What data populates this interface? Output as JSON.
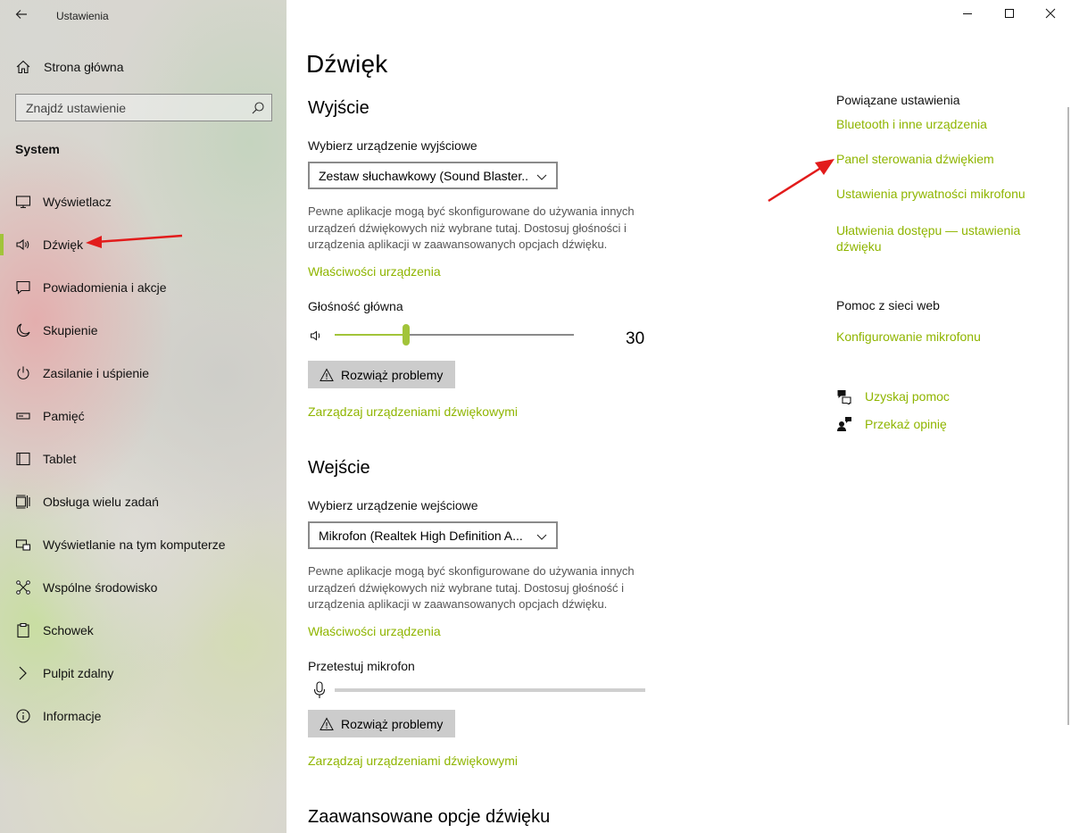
{
  "window": {
    "app_title": "Ustawienia",
    "controls": [
      "minimize-icon",
      "maximize-icon",
      "close-icon"
    ]
  },
  "sidebar": {
    "home_label": "Strona główna",
    "search_placeholder": "Znajdź ustawienie",
    "section": "System",
    "items": [
      {
        "label": "Wyświetlacz",
        "icon": "monitor-icon"
      },
      {
        "label": "Dźwięk",
        "icon": "speaker-icon",
        "active": true
      },
      {
        "label": "Powiadomienia i akcje",
        "icon": "notification-icon"
      },
      {
        "label": "Skupienie",
        "icon": "moon-icon"
      },
      {
        "label": "Zasilanie i uśpienie",
        "icon": "power-icon"
      },
      {
        "label": "Pamięć",
        "icon": "storage-icon"
      },
      {
        "label": "Tablet",
        "icon": "tablet-icon"
      },
      {
        "label": "Obsługa wielu zadań",
        "icon": "multitasking-icon"
      },
      {
        "label": "Wyświetlanie na tym komputerze",
        "icon": "projecting-icon"
      },
      {
        "label": "Wspólne środowisko",
        "icon": "shared-experiences-icon"
      },
      {
        "label": "Schowek",
        "icon": "clipboard-icon"
      },
      {
        "label": "Pulpit zdalny",
        "icon": "remote-desktop-icon"
      },
      {
        "label": "Informacje",
        "icon": "info-icon"
      }
    ]
  },
  "main": {
    "title": "Dźwięk",
    "output": {
      "heading": "Wyjście",
      "device_label": "Wybierz urządzenie wyjściowe",
      "device_value": "Zestaw słuchawkowy (Sound Blaster...",
      "description": "Pewne aplikacje mogą być skonfigurowane do używania innych urządzeń dźwiękowych niż wybrane tutaj. Dostosuj głośności i urządzenia aplikacji w zaawansowanych opcjach dźwięku.",
      "properties_link": "Właściwości urządzenia",
      "volume_label": "Głośność główna",
      "volume_value": "30",
      "volume_level": 0.3,
      "troubleshoot": "Rozwiąż problemy",
      "manage_link": "Zarządzaj urządzeniami dźwiękowymi"
    },
    "input": {
      "heading": "Wejście",
      "device_label": "Wybierz urządzenie wejściowe",
      "device_value": "Mikrofon (Realtek High Definition A...",
      "description": "Pewne aplikacje mogą być skonfigurowane do używania innych urządzeń dźwiękowych niż wybrane tutaj. Dostosuj głośność i urządzenia aplikacji w zaawansowanych opcjach dźwięku.",
      "properties_link": "Właściwości urządzenia",
      "test_label": "Przetestuj mikrofon",
      "mic_level": 0,
      "troubleshoot": "Rozwiąż problemy",
      "manage_link": "Zarządzaj urządzeniami dźwiękowymi"
    },
    "advanced_heading": "Zaawansowane opcje dźwięku"
  },
  "related": {
    "heading": "Powiązane ustawienia",
    "links": [
      "Bluetooth i inne urządzenia",
      "Panel sterowania dźwiękiem",
      "Ustawienia prywatności mikrofonu",
      "Ułatwienia dostępu — ustawienia dźwięku"
    ]
  },
  "web_help": {
    "heading": "Pomoc z sieci web",
    "link": "Konfigurowanie mikrofonu"
  },
  "help": {
    "get_help": "Uzyskaj pomoc",
    "feedback": "Przekaż opinię"
  },
  "colors": {
    "accent": "#a2c43a",
    "link": "#8fb500",
    "annotation_arrow": "#e21b1b"
  }
}
